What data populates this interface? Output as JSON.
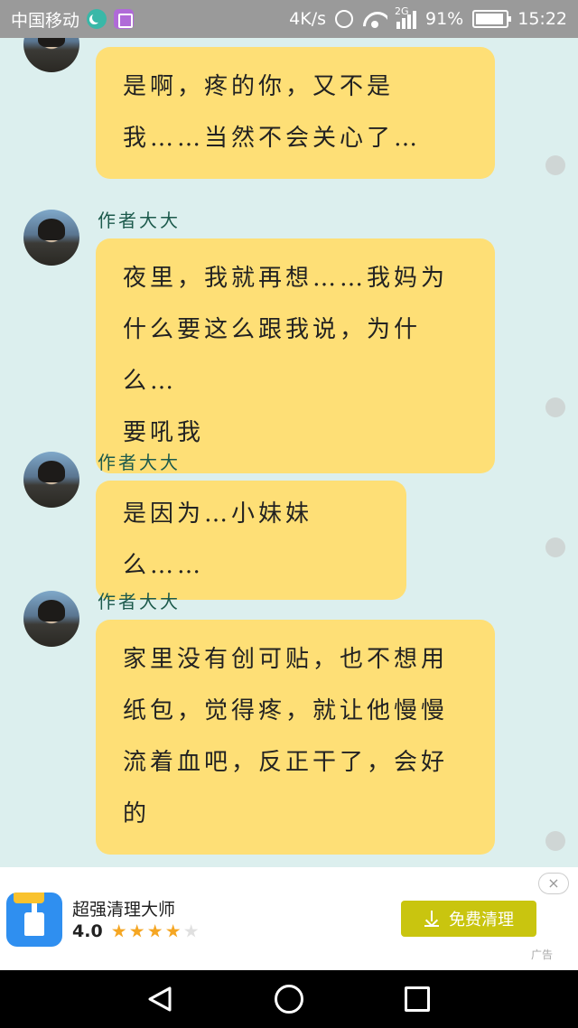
{
  "status_bar": {
    "carrier": "中国移动",
    "speed": "4K/s",
    "network": "2G",
    "battery": "91%",
    "time": "15:22"
  },
  "messages": [
    {
      "sender": "",
      "text_lines": [
        "是啊，疼的你，又不是",
        "我……当然不会关心了…"
      ]
    },
    {
      "sender": "作者大大",
      "text_lines": [
        "夜里，我就再想……我妈为",
        "什么要这么跟我说，为什么…",
        "要吼我"
      ]
    },
    {
      "sender": "作者大大",
      "text_lines": [
        "是因为…小妹妹么……"
      ]
    },
    {
      "sender": "作者大大",
      "text_lines": [
        "家里没有创可贴，也不想用",
        "纸包，觉得疼，就让他慢慢",
        "流着血吧，反正干了，会好",
        "的"
      ]
    }
  ],
  "ad": {
    "app_name": "超强清理大师",
    "rating": "4.0",
    "stars_filled": 4,
    "stars_total": 5,
    "button_label": "免费清理",
    "close_label": "×",
    "ad_label": "广告"
  },
  "colors": {
    "chat_background": "#dcefee",
    "bubble": "#fedf76",
    "sender_name": "#1c5a4c",
    "ad_button": "#c9c50f",
    "status_bar": "#9a9a9a"
  }
}
